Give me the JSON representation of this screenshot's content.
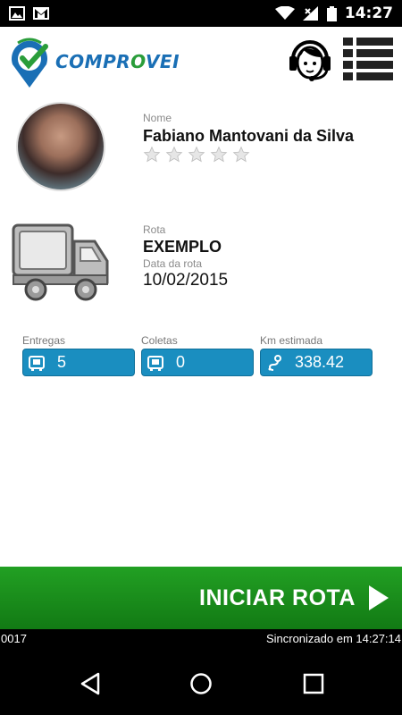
{
  "status_bar": {
    "time": "14:27"
  },
  "header": {
    "logo_text_1": "COMPR",
    "logo_text_2": "O",
    "logo_text_3": "VEI"
  },
  "profile": {
    "name_label": "Nome",
    "name": "Fabiano Mantovani da Silva",
    "rating": 0,
    "max_rating": 5
  },
  "route": {
    "label": "Rota",
    "name": "EXEMPLO",
    "date_label": "Data da rota",
    "date": "10/02/2015"
  },
  "stats": [
    {
      "label": "Entregas",
      "value": "5",
      "icon": "box-icon"
    },
    {
      "label": "Coletas",
      "value": "0",
      "icon": "box-icon"
    },
    {
      "label": "Km estimada",
      "value": "338.42",
      "icon": "route-icon"
    }
  ],
  "action": {
    "label": "INICIAR ROTA"
  },
  "footer": {
    "left": "0017",
    "right": "Sincronizado em 14:27:14"
  },
  "colors": {
    "accent": "#1a8ec0",
    "action": "#1a8f1c",
    "brand_blue": "#1a6fb5",
    "brand_green": "#2a9d3a"
  }
}
